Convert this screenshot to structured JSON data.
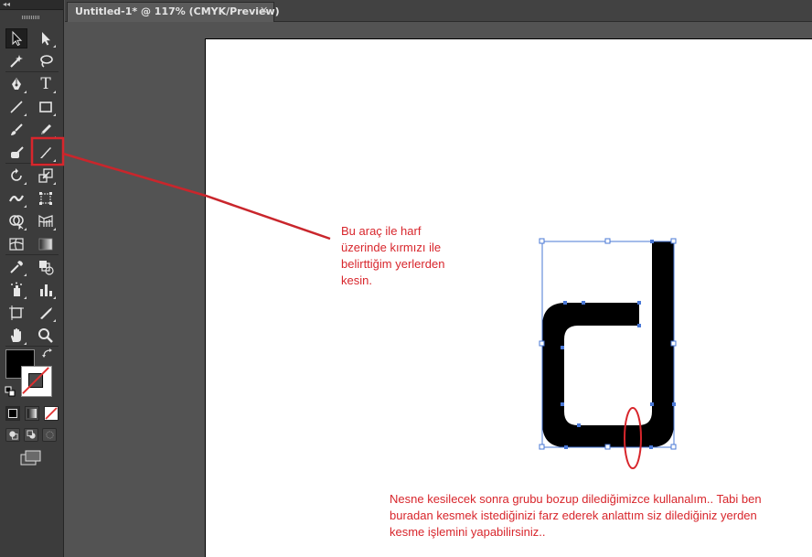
{
  "window": {
    "collapse_glyph": "◂◂"
  },
  "document_tab": {
    "title": "Untitled-1* @ 117% (CMYK/Preview)",
    "close_glyph": "✕"
  },
  "toolbar": {
    "rows": [
      [
        "selection-tool",
        "direct-selection-tool"
      ],
      [
        "magic-wand-tool",
        "lasso-tool"
      ],
      [
        "pen-tool",
        "type-tool"
      ],
      [
        "line-segment-tool",
        "rectangle-tool"
      ],
      [
        "paintbrush-tool",
        "pencil-tool"
      ],
      [
        "blob-brush-tool",
        "knife-tool"
      ],
      [
        "rotate-tool",
        "scale-tool"
      ],
      [
        "width-tool",
        "free-transform-tool"
      ],
      [
        "shape-builder-tool",
        "perspective-grid-tool"
      ],
      [
        "mesh-tool",
        "gradient-tool"
      ],
      [
        "eyedropper-tool",
        "blend-tool"
      ],
      [
        "symbol-sprayer-tool",
        "column-graph-tool"
      ],
      [
        "artboard-tool",
        "slice-tool"
      ],
      [
        "hand-tool",
        "zoom-tool"
      ]
    ],
    "active_tool": "knife-tool",
    "type_glyph": "T",
    "fill_color": "#000000",
    "stroke_color": "none"
  },
  "annotations": {
    "tool_note": "Bu araç ile harf\nüzerinde kırmızı ile\nbelirttiğim yerlerden\nkesin.",
    "bottom_note": "Nesne kesilecek sonra grubu bozup dilediğimizce kullanalım.. Tabi ben\nburadan kesmek istediğinizi farz ederek anlattım siz dilediğiniz yerden\nkesme işlemini yapabilirsiniz..",
    "highlight_color": "#d8262c",
    "selection_color": "#4a78d6"
  }
}
